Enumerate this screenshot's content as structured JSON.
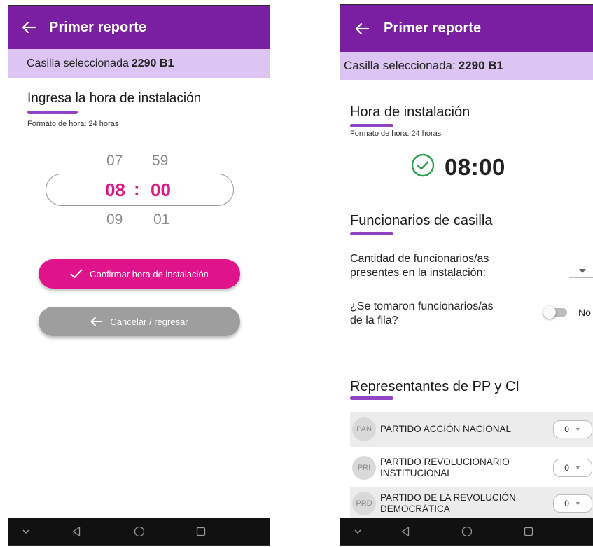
{
  "left_screen": {
    "title": "Primer reporte",
    "casilla_label": "Casilla seleccionada",
    "casilla_value": "2290 B1",
    "section_title": "Ingresa la hora de instalación",
    "format_note": "Formato de hora: 24 horas",
    "picker": {
      "hour_prev": "07",
      "minute_prev": "59",
      "hour": "08",
      "separator": ":",
      "minute": "00",
      "hour_next": "09",
      "minute_next": "01"
    },
    "confirm_label": "Confirmar hora de instalación",
    "cancel_label": "Cancelar / regresar"
  },
  "right_screen": {
    "title": "Primer reporte",
    "casilla_label": "Casilla seleccionada:",
    "casilla_value": "2290 B1",
    "hora_title": "Hora de instalación",
    "format_note": "Formato de hora: 24 horas",
    "hora_value": "08:00",
    "funcionarios_title": "Funcionarios de casilla",
    "cantidad_label": "Cantidad de funcionarios/as presentes en la instalación:",
    "cantidad_label_line1": "Cantidad de funcionarios/as",
    "cantidad_label_line2": "presentes en la instalación:",
    "fila_label_line1": "¿Se tomaron funcionarios/as",
    "fila_label_line2": "de la fila?",
    "fila_toggle_value": "No",
    "representantes_title": "Representantes de PP y CI",
    "parties": [
      {
        "abbr": "PAN",
        "name": "PARTIDO ACCIÓN NACIONAL",
        "count": "0"
      },
      {
        "abbr": "PRI",
        "name": "PARTIDO REVOLUCIONARIO INSTITUCIONAL",
        "count": "0"
      },
      {
        "abbr": "PRD",
        "name": "PARTIDO DE LA REVOLUCIÓN DEMOCRÁTICA",
        "count": "0"
      }
    ]
  },
  "colors": {
    "appbar": "#7b1fa2",
    "casilla_bar": "#dcc4f3",
    "accent_pink": "#e0148a",
    "cancel_gray": "#9e9e9e",
    "underline_purple": "#8e44c4",
    "check_green": "#2e9e4f"
  },
  "icons": [
    "back-arrow-icon",
    "check-icon",
    "check-circle-icon",
    "dropdown-arrow-icon",
    "nav-down-icon",
    "nav-back-icon",
    "nav-home-icon",
    "nav-recents-icon"
  ]
}
